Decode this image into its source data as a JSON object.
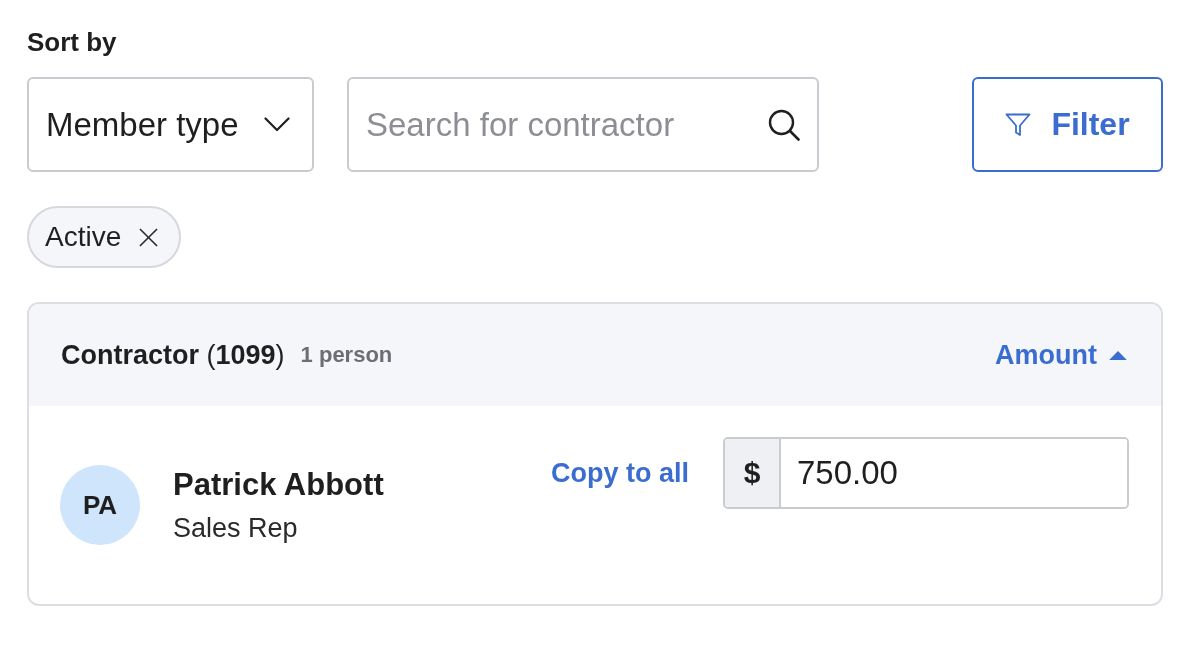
{
  "sort": {
    "label": "Sort by",
    "dropdown": {
      "value": "Member type"
    },
    "search": {
      "placeholder": "Search for contractor"
    },
    "filter_button": {
      "label": "Filter"
    }
  },
  "chips": [
    {
      "label": "Active"
    }
  ],
  "group": {
    "title": "**Contractor** (**1099**)",
    "count": "1 person",
    "sort_column": {
      "label": "Amount",
      "ascending": true
    }
  },
  "rows": [
    {
      "initials": "PA",
      "name": "Patrick Abbott",
      "role": "Sales Rep",
      "copy_link": "Copy to all",
      "currency": "$",
      "amount": "750.00"
    }
  ]
}
